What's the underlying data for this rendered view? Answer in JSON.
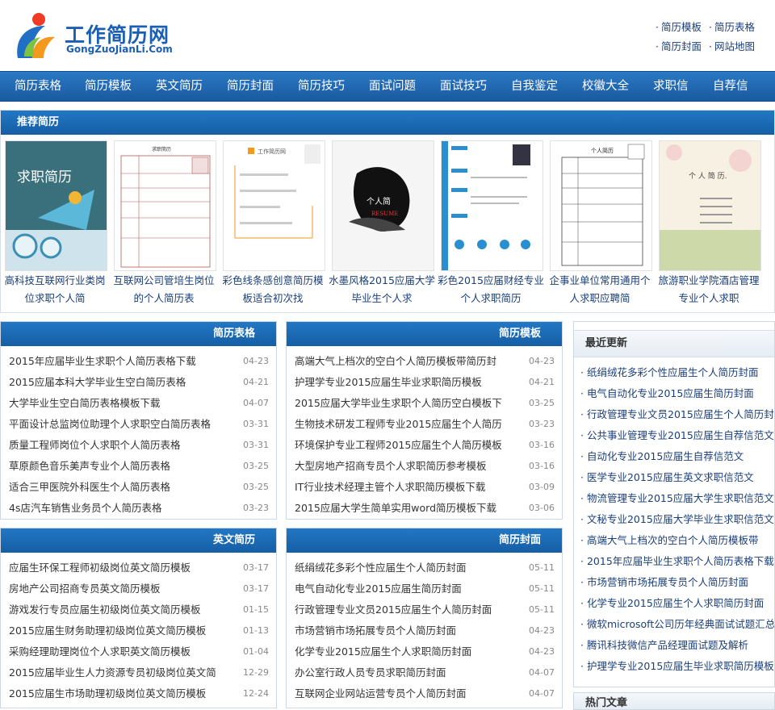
{
  "header": {
    "logo_cn": "工作简历网",
    "logo_en": "GongZuoJianLi.Com",
    "top_links": [
      "简历模板",
      "简历表格",
      "简历封面",
      "网站地图"
    ]
  },
  "nav": [
    "简历表格",
    "简历模板",
    "英文简历",
    "简历封面",
    "简历技巧",
    "面试问题",
    "面试技巧",
    "自我鉴定",
    "校徽大全",
    "求职信",
    "自荐信"
  ],
  "recommend": {
    "title": "推荐简历",
    "thumb_text": {
      "t1": "求职简历",
      "t2": "求职简历",
      "t3": "工作简历网",
      "t4_cn": "个人简",
      "t4_en": "RESUME",
      "t6": "个人简历",
      "t7": "个 人 简 历."
    },
    "items": [
      {
        "line1": "高科技互联网行业类岗",
        "line2": "位求职个人简"
      },
      {
        "line1": "互联网公司管培生岗位",
        "line2": "的个人简历表"
      },
      {
        "line1": "彩色线条感创意简历模",
        "line2": "板适合初次找"
      },
      {
        "line1": "水墨风格2015应届大学",
        "line2": "毕业生个人求"
      },
      {
        "line1": "彩色2015应届财经专业",
        "line2": "个人求职简历"
      },
      {
        "line1": "企事业单位常用通用个",
        "line2": "人求职应聘简"
      },
      {
        "line1": "旅游职业学院酒店管理",
        "line2": "专业个人求职"
      }
    ]
  },
  "panels": [
    {
      "title": "简历表格",
      "rows": [
        {
          "text": "2015年应届毕业生求职个人简历表格下载",
          "date": "04-23"
        },
        {
          "text": "2015应届本科大学毕业生空白简历表格",
          "date": "04-21"
        },
        {
          "text": "大学毕业生空白简历表格模板下载",
          "date": "04-07"
        },
        {
          "text": "平面设计总监岗位助理个人求职空白简历表格",
          "date": "03-31"
        },
        {
          "text": "质量工程师岗位个人求职个人简历表格",
          "date": "03-31"
        },
        {
          "text": "草原颜色音乐美声专业个人简历表格",
          "date": "03-25"
        },
        {
          "text": "适合三甲医院外科医生个人简历表格",
          "date": "03-25"
        },
        {
          "text": "4s店汽车销售业务员个人简历表格",
          "date": "03-23"
        }
      ]
    },
    {
      "title": "简历模板",
      "rows": [
        {
          "text": "高端大气上档次的空白个人简历模板带简历封",
          "date": "04-23"
        },
        {
          "text": "护理学专业2015应届生毕业求职简历模板",
          "date": "04-21"
        },
        {
          "text": "2015应届大学毕业生求职个人简历空白模板下",
          "date": "03-25"
        },
        {
          "text": "生物技术研发工程师专业2015应届生个人简历",
          "date": "03-23"
        },
        {
          "text": "环境保护专业工程师2015应届生个人简历模板",
          "date": "03-16"
        },
        {
          "text": "大型房地产招商专员个人求职简历参考模板",
          "date": "03-16"
        },
        {
          "text": "IT行业技术经理主管个人求职简历模板下载",
          "date": "03-09"
        },
        {
          "text": "2015应届大学生简单实用word简历模板下载",
          "date": "03-06"
        }
      ]
    },
    {
      "title": "英文简历",
      "rows": [
        {
          "text": "应届生环保工程师初级岗位英文简历模板",
          "date": "03-17"
        },
        {
          "text": "房地产公司招商专员英文简历模板",
          "date": "03-17"
        },
        {
          "text": "游戏发行专员应届生初级岗位英文简历模板",
          "date": "01-15"
        },
        {
          "text": "2015应届生财务助理初级岗位英文简历模板",
          "date": "01-13"
        },
        {
          "text": "采购经理助理岗位个人求职英文简历模板",
          "date": "01-04"
        },
        {
          "text": "2015应届毕业生人力资源专员初级岗位英文简",
          "date": "12-29"
        },
        {
          "text": "2015应届生市场助理初级岗位英文简历模板",
          "date": "12-24"
        }
      ]
    },
    {
      "title": "简历封面",
      "rows": [
        {
          "text": "纸绢绒花多彩个性应届生个人简历封面",
          "date": "05-11"
        },
        {
          "text": "电气自动化专业2015应届生简历封面",
          "date": "05-11"
        },
        {
          "text": "行政管理专业文员2015应届生个人简历封面",
          "date": "05-11"
        },
        {
          "text": "市场营销市场拓展专员个人简历封面",
          "date": "04-23"
        },
        {
          "text": "化学专业2015应届生个人求职简历封面",
          "date": "04-23"
        },
        {
          "text": "办公室行政人员专员求职简历封面",
          "date": "04-07"
        },
        {
          "text": "互联网企业网站运营专员个人简历封面",
          "date": "04-07"
        }
      ]
    }
  ],
  "sidebar": {
    "title": "最近更新",
    "items": [
      "纸绢绒花多彩个性应届生个人简历封面",
      "电气自动化专业2015应届生简历封面",
      "行政管理专业文员2015应届生个人简历封",
      "公共事业管理专业2015应届生自荐信范文",
      "自动化专业2015应届生自荐信范文",
      "医学专业2015应届生英文求职信范文",
      "物流管理专业2015应届大学生求职信范文",
      "文秘专业2015应届大学毕业生求职信范文",
      "高端大气上档次的空白个人简历模板带",
      "2015年应届毕业生求职个人简历表格下载",
      "市场营销市场拓展专员个人简历封面",
      "化学专业2015应届生个人求职简历封面",
      "微软microsoft公司历年经典面试试题汇总",
      "腾讯科技微信产品经理面试题及解析",
      "护理学专业2015应届生毕业求职简历模板"
    ],
    "title2": "热门文章"
  },
  "colors": {
    "nav": "#195aa0",
    "link": "#1a3f7a",
    "brand": "#1a5fb4"
  }
}
